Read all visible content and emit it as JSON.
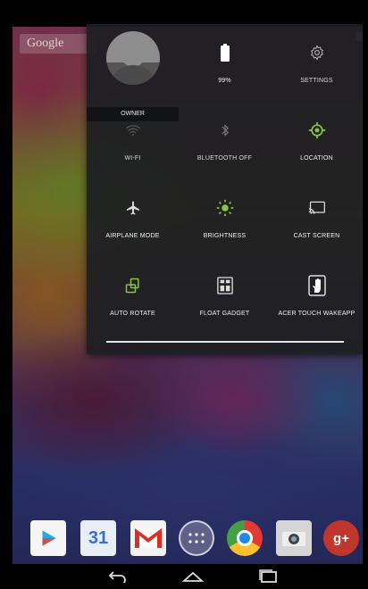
{
  "home": {
    "search_label": "Google"
  },
  "quick_settings": {
    "owner": {
      "label": "OWNER"
    },
    "tiles": [
      {
        "id": "battery",
        "label": "99%",
        "icon": "battery-icon",
        "active": true
      },
      {
        "id": "settings",
        "label": "SETTINGS",
        "icon": "gear-icon",
        "active": false
      },
      {
        "id": "wifi",
        "label": "WI-FI",
        "icon": "wifi-icon",
        "active": false
      },
      {
        "id": "bluetooth",
        "label": "BLUETOOTH OFF",
        "icon": "bluetooth-icon",
        "active": false
      },
      {
        "id": "location",
        "label": "LOCATION",
        "icon": "location-icon",
        "active": true
      },
      {
        "id": "airplane",
        "label": "AIRPLANE MODE",
        "icon": "airplane-icon",
        "active": false
      },
      {
        "id": "brightness",
        "label": "BRIGHTNESS",
        "icon": "brightness-icon",
        "active": true
      },
      {
        "id": "cast",
        "label": "CAST SCREEN",
        "icon": "cast-icon",
        "active": false
      },
      {
        "id": "rotate",
        "label": "AUTO ROTATE",
        "icon": "rotate-icon",
        "active": true
      },
      {
        "id": "float",
        "label": "FLOAT GADGET",
        "icon": "float-gadget-icon",
        "active": false
      },
      {
        "id": "touch",
        "label": "ACER TOUCH WAKEAPP",
        "icon": "touch-hand-icon",
        "active": false
      }
    ],
    "accent_color": "#8bc34a"
  },
  "dock": {
    "calendar_day": "31",
    "apps": [
      {
        "name": "Play Store",
        "icon": "play-store-icon"
      },
      {
        "name": "Calendar",
        "icon": "calendar-icon"
      },
      {
        "name": "Gmail",
        "icon": "gmail-icon"
      },
      {
        "name": "App Drawer",
        "icon": "app-drawer-icon"
      },
      {
        "name": "Chrome",
        "icon": "chrome-icon"
      },
      {
        "name": "Camera",
        "icon": "camera-icon"
      },
      {
        "name": "Google+",
        "icon": "google-plus-icon"
      }
    ],
    "gplus_label": "g+"
  },
  "navbar": {
    "buttons": [
      "back",
      "home",
      "recents"
    ]
  }
}
